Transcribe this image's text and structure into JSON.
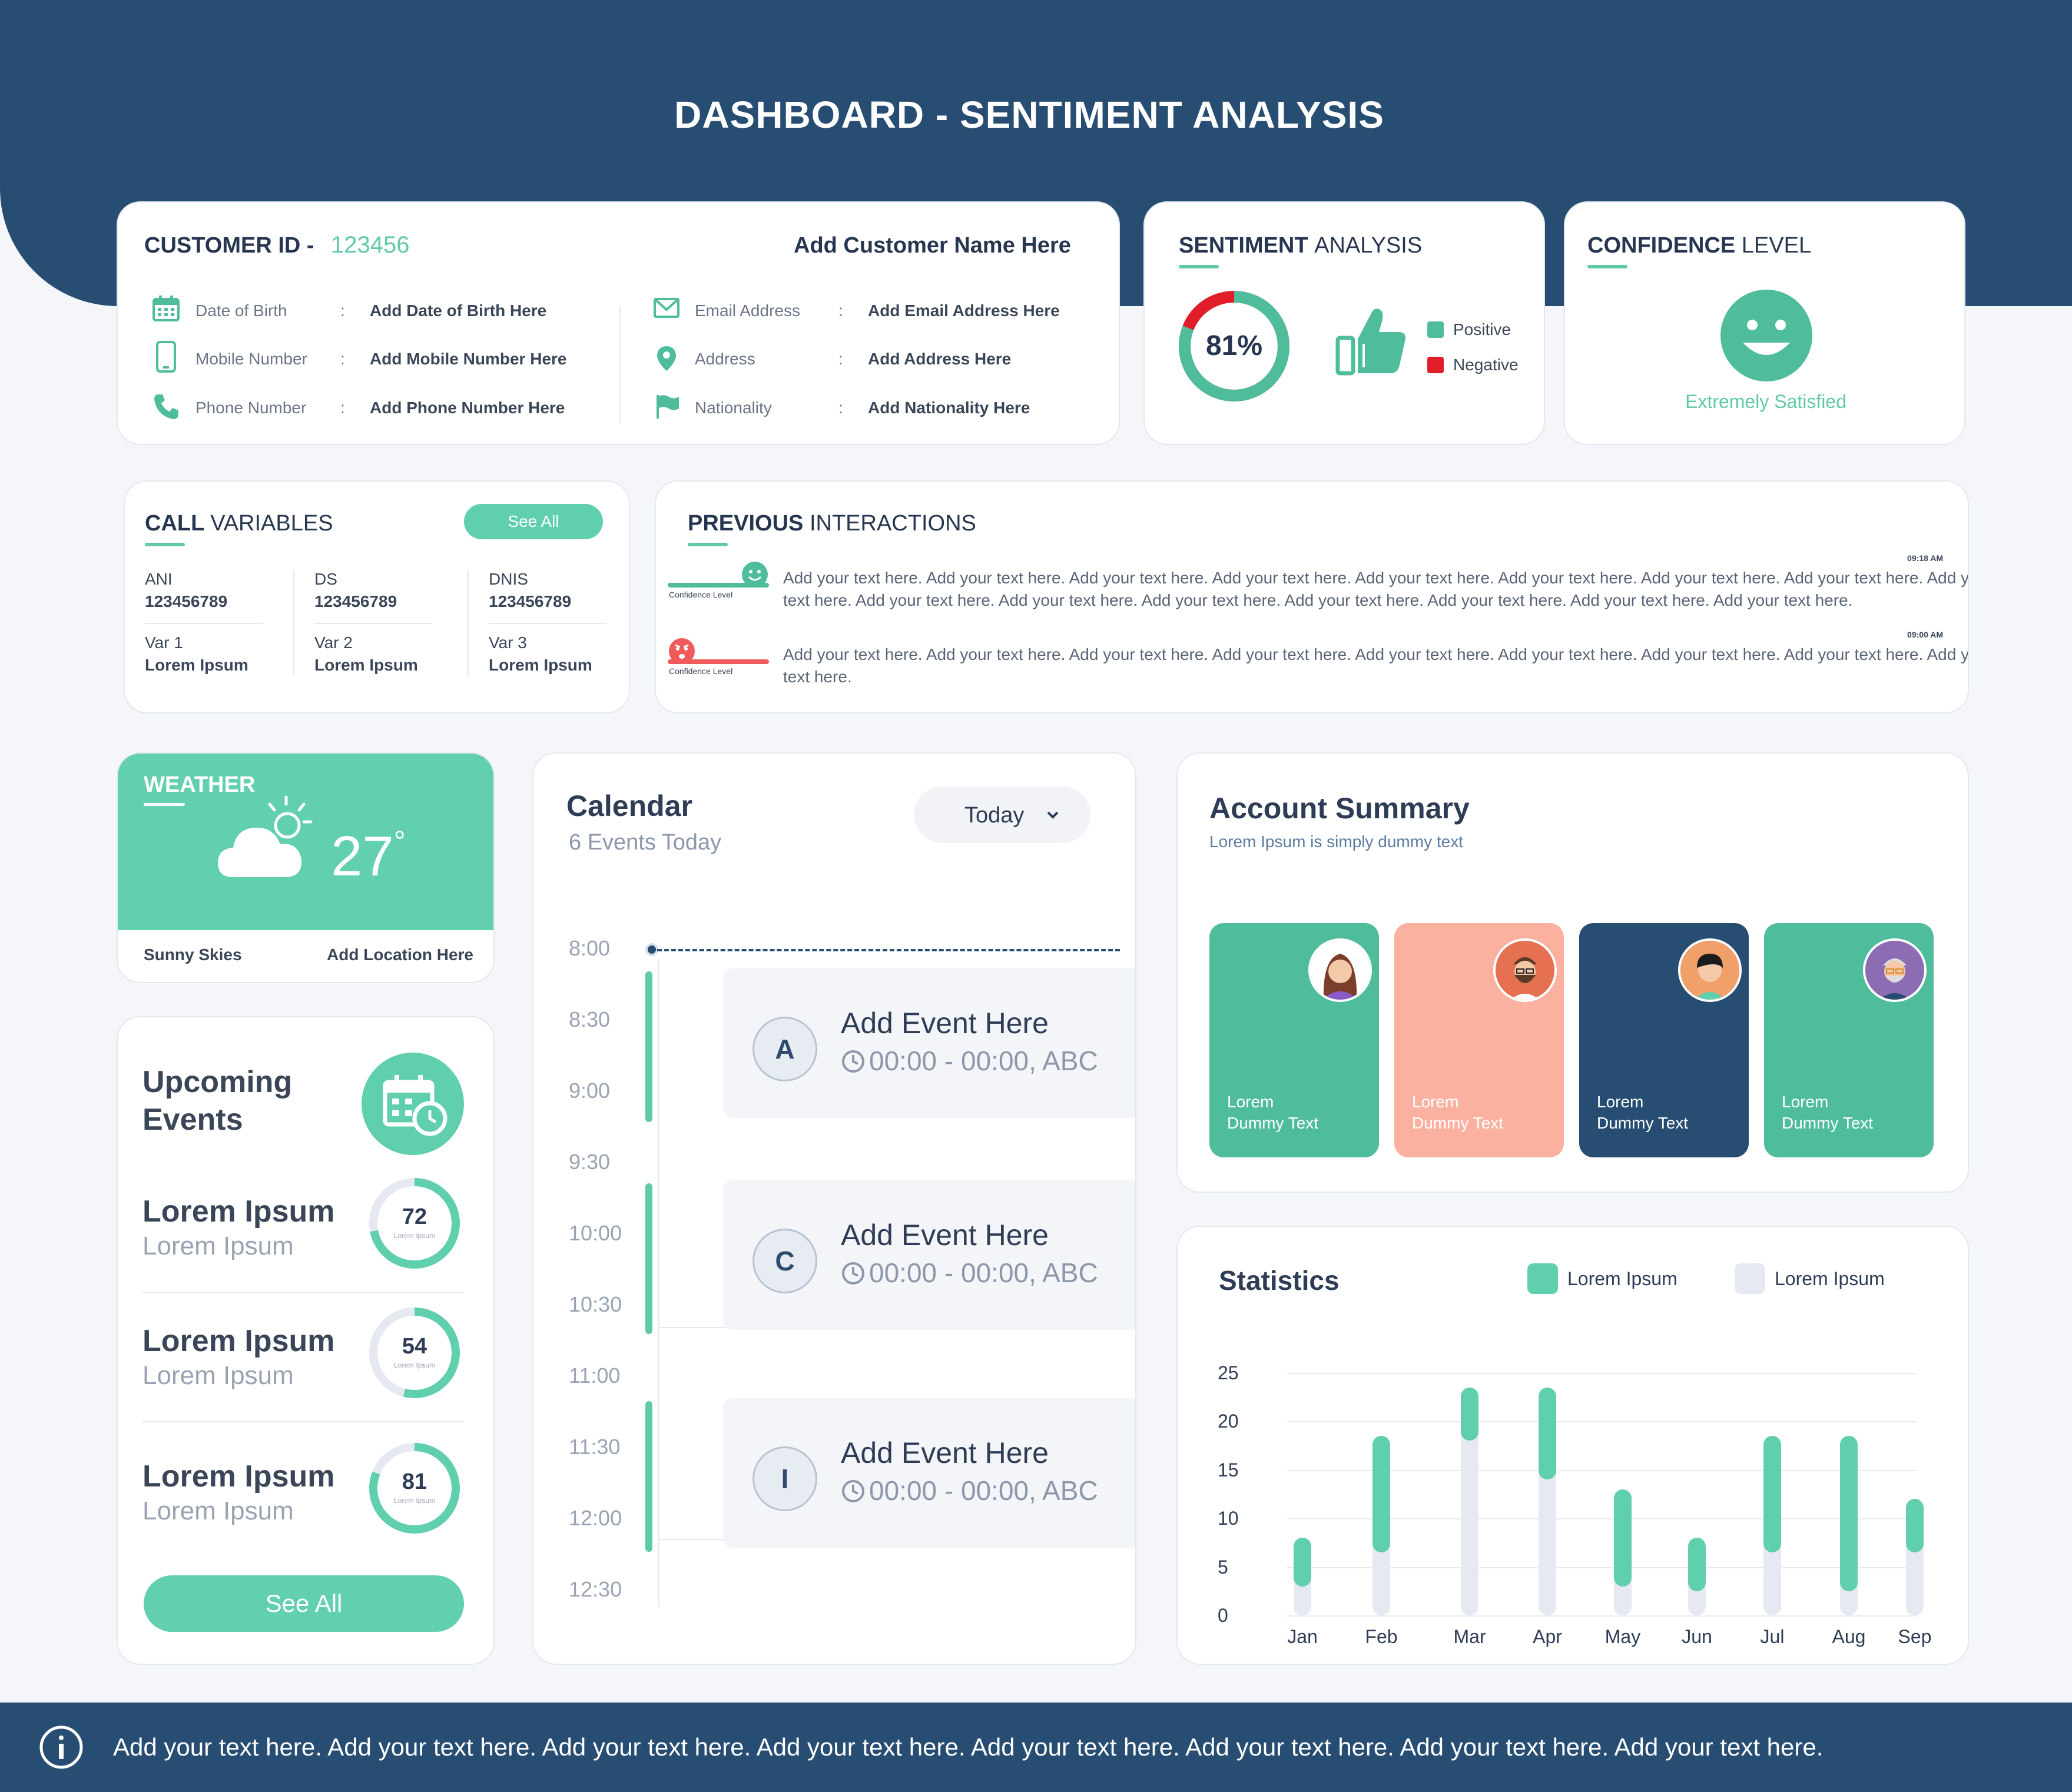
{
  "header": {
    "title": "DASHBOARD - SENTIMENT ANALYSIS"
  },
  "customer": {
    "id_label": "CUSTOMER ID -",
    "id_value": "123456",
    "name_placeholder": "Add Customer Name Here",
    "fields_left": [
      {
        "label": "Date of Birth",
        "value": "Add Date of Birth Here",
        "icon": "calendar-icon"
      },
      {
        "label": "Mobile Number",
        "value": "Add Mobile Number Here",
        "icon": "mobile-icon"
      },
      {
        "label": "Phone Number",
        "value": "Add Phone Number Here",
        "icon": "phone-icon"
      }
    ],
    "fields_right": [
      {
        "label": "Email Address",
        "value": "Add Email Address Here",
        "icon": "mail-icon"
      },
      {
        "label": "Address",
        "value": "Add Address Here",
        "icon": "location-pin-icon"
      },
      {
        "label": "Nationality",
        "value": "Add Nationality Here",
        "icon": "flag-icon"
      }
    ],
    "colon": ":"
  },
  "sentiment": {
    "title_bold": "SENTIMENT",
    "title_light": "ANALYSIS",
    "percent": "81%",
    "positive_fraction": 0.81,
    "legend_positive": "Positive",
    "legend_negative": "Negative",
    "positive_color": "#4fbd9c",
    "negative_color": "#e11d2a"
  },
  "confidence": {
    "title_bold": "CONFIDENCE",
    "title_light": "LEVEL",
    "status": "Extremely Satisfied"
  },
  "call_variables": {
    "title_bold": "CALL",
    "title_light": "VARIABLES",
    "see_all": "See All",
    "columns": [
      {
        "top_label": "ANI",
        "top_value": "123456789",
        "bottom_label": "Var 1",
        "bottom_value": "Lorem Ipsum"
      },
      {
        "top_label": "DS",
        "top_value": "123456789",
        "bottom_label": "Var 2",
        "bottom_value": "Lorem Ipsum"
      },
      {
        "top_label": "DNIS",
        "top_value": "123456789",
        "bottom_label": "Var 3",
        "bottom_value": "Lorem Ipsum"
      }
    ]
  },
  "previous": {
    "title_bold": "PREVIOUS",
    "title_light": "INTERACTIONS",
    "items": [
      {
        "time": "09:18 AM",
        "confidence_label": "Confidence Level",
        "mood": "happy",
        "line1": "Add your text here. Add your text here. Add your text here. Add your text here. Add your text here. Add your text here. Add your text here. Add your text here. Add your",
        "line2": "text here. Add your text here. Add your text here. Add your text here. Add your text here. Add your text here. Add your text here. Add your text here."
      },
      {
        "time": "09:00 AM",
        "confidence_label": "Confidence Level",
        "mood": "angry",
        "line1": "Add your text here. Add your text here. Add your text here. Add your text here. Add your text here. Add your text here. Add your text here. Add your text here. Add your",
        "line2": "text here."
      }
    ]
  },
  "weather": {
    "title": "WEATHER",
    "temperature": "27",
    "degree": "°",
    "condition": "Sunny Skies",
    "location": "Add Location Here"
  },
  "upcoming": {
    "title_line1": "Upcoming",
    "title_line2": "Events",
    "see_all": "See All",
    "items": [
      {
        "title": "Lorem Ipsum",
        "subtitle": "Lorem Ipsum",
        "value": "72",
        "caption": "Lorem Ipsum",
        "fraction": 0.72
      },
      {
        "title": "Lorem Ipsum",
        "subtitle": "Lorem Ipsum",
        "value": "54",
        "caption": "Lorem Ipsum",
        "fraction": 0.54
      },
      {
        "title": "Lorem Ipsum",
        "subtitle": "Lorem Ipsum",
        "value": "81",
        "caption": "Lorem Ipsum",
        "fraction": 0.81
      }
    ]
  },
  "calendar": {
    "title": "Calendar",
    "subtitle": "6 Events Today",
    "dropdown": "Today",
    "hours": [
      "8:00",
      "8:30",
      "9:00",
      "9:30",
      "10:00",
      "10:30",
      "11:00",
      "11:30",
      "12:00",
      "12:30"
    ],
    "events": [
      {
        "letter": "A",
        "title": "Add Event Here",
        "time": "00:00 - 00:00, ABC"
      },
      {
        "letter": "C",
        "title": "Add Event Here",
        "time": "00:00 - 00:00, ABC"
      },
      {
        "letter": "I",
        "title": "Add Event Here",
        "time": "00:00 - 00:00, ABC"
      }
    ]
  },
  "account": {
    "title": "Account Summary",
    "subtitle": "Lorem Ipsum is simply dummy text",
    "people": [
      {
        "line1": "Lorem",
        "line2": "Dummy Text",
        "color": "#4fbd9c"
      },
      {
        "line1": "Lorem",
        "line2": "Dummy Text",
        "color": "#fbb1a0"
      },
      {
        "line1": "Lorem",
        "line2": "Dummy Text",
        "color": "#274d72"
      },
      {
        "line1": "Lorem",
        "line2": "Dummy Text",
        "color": "#4fbd9c"
      }
    ]
  },
  "statistics": {
    "title": "Statistics",
    "legend": [
      "Lorem Ipsum",
      "Lorem Ipsum"
    ],
    "legend_colors": [
      "#5fcfae",
      "#e6e9f2"
    ]
  },
  "chart_data": {
    "type": "bar",
    "categories": [
      "Jan",
      "Feb",
      "Mar",
      "Apr",
      "May",
      "Jun",
      "Jul",
      "Aug",
      "Sep"
    ],
    "yticks": [
      0,
      5,
      10,
      15,
      20,
      25
    ],
    "ylim": [
      0,
      25
    ],
    "series": [
      {
        "name": "Lorem Ipsum",
        "ranges": [
          [
            3,
            8
          ],
          [
            6.5,
            18.5
          ],
          [
            18,
            23.5
          ],
          [
            14,
            23.5
          ],
          [
            3,
            13
          ],
          [
            2.5,
            8
          ],
          [
            6.5,
            18.5
          ],
          [
            2.5,
            18.5
          ],
          [
            6.5,
            12
          ]
        ]
      },
      {
        "name": "Lorem Ipsum",
        "values": [
          3,
          6.5,
          18,
          14,
          3,
          2.5,
          6.5,
          2.5,
          6.5
        ]
      }
    ]
  },
  "footer": {
    "text": "Add your text here. Add your text here. Add your text here. Add your text here. Add your text here. Add your text here. Add your text here. Add your text here."
  }
}
